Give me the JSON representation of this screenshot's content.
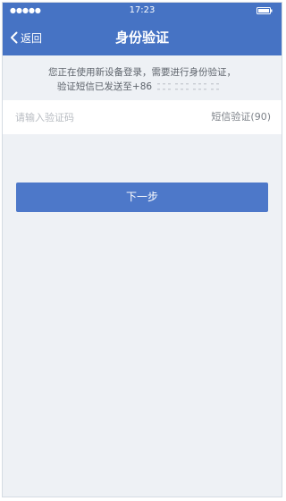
{
  "status_bar": {
    "signal": "●●●●●",
    "time": "17:23"
  },
  "nav": {
    "back_label": "返回",
    "title": "身份验证"
  },
  "info": {
    "line1": "您正在使用新设备登录，需要进行身份验证，",
    "line2_prefix": "验证短信已发送至+86"
  },
  "code_input": {
    "placeholder": "请输入验证码",
    "value": ""
  },
  "sms": {
    "label": "短信验证(90)"
  },
  "next_button": {
    "label": "下一步"
  },
  "colors": {
    "brand": "#4673c4",
    "button": "#4d78c9",
    "background": "#eef1f5"
  },
  "icons": {
    "back": "chevron-left-icon",
    "battery": "battery-icon"
  }
}
